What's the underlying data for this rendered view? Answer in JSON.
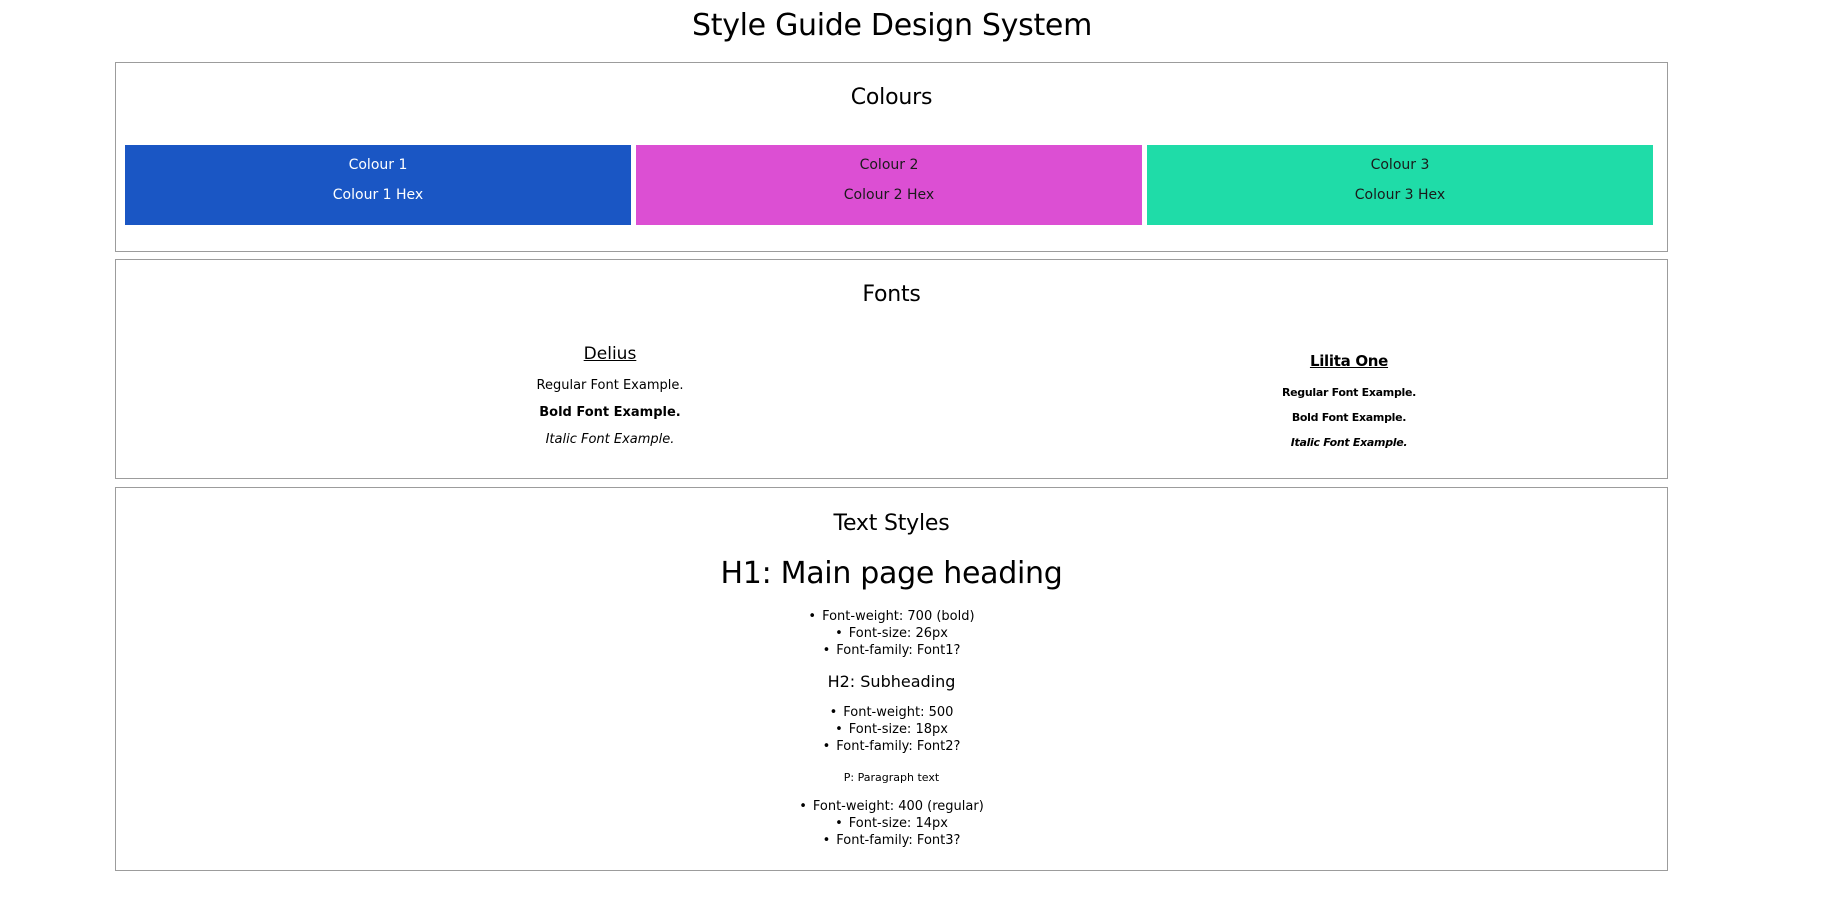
{
  "page": {
    "title": "Style Guide Design System"
  },
  "colours": {
    "heading": "Colours",
    "swatches": [
      {
        "name": "Colour 1",
        "hex_label": "Colour 1 Hex",
        "color": "#1a56c4",
        "text_color": "#ffffff"
      },
      {
        "name": "Colour 2",
        "hex_label": "Colour 2 Hex",
        "color": "#dc4fd3",
        "text_color": "#1a1a1a"
      },
      {
        "name": "Colour 3",
        "hex_label": "Colour 3 Hex",
        "color": "#1fdca8",
        "text_color": "#1a1a1a"
      }
    ]
  },
  "fonts": {
    "heading": "Fonts",
    "families": [
      {
        "name": "Delius",
        "regular": "Regular Font Example.",
        "bold": "Bold Font Example.",
        "italic": "Italic Font Example."
      },
      {
        "name": "Lilita One",
        "regular": "Regular Font Example.",
        "bold": "Bold Font Example.",
        "italic": "Italic Font Example."
      }
    ]
  },
  "text_styles": {
    "heading": "Text Styles",
    "h1": {
      "sample": "H1: Main page heading",
      "specs": [
        "Font-weight: 700 (bold)",
        "Font-size: 26px",
        "Font-family: Font1?"
      ]
    },
    "h2": {
      "sample": "H2: Subheading",
      "specs": [
        "Font-weight: 500",
        "Font-size: 18px",
        "Font-family: Font2?"
      ]
    },
    "p": {
      "sample": "P: Paragraph text",
      "specs": [
        "Font-weight: 400 (regular)",
        "Font-size: 14px",
        "Font-family: Font3?"
      ]
    }
  }
}
